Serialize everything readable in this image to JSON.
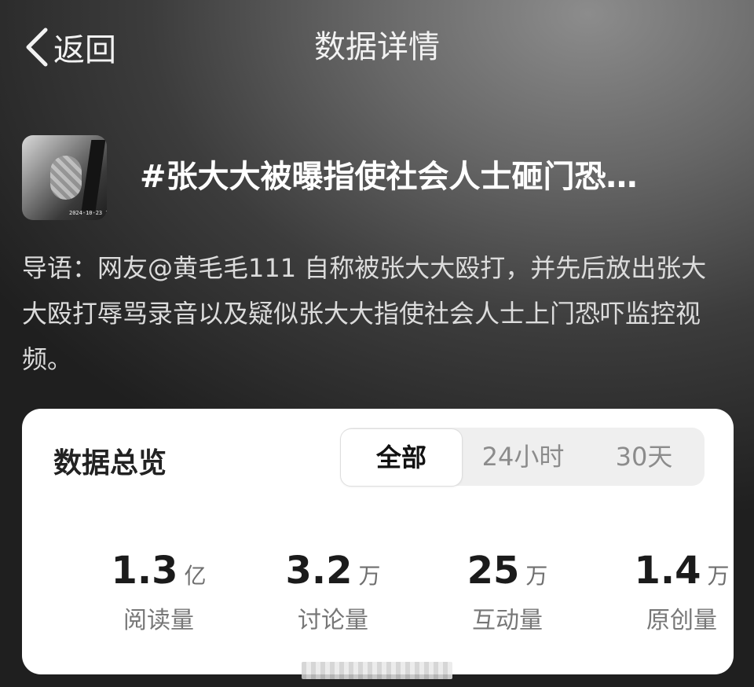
{
  "header": {
    "back_label": "返回",
    "title": "数据详情"
  },
  "topic": {
    "title": "#张大大被曝指使社会人士砸门恐…",
    "thumb_timestamp": "2024-10-23 2",
    "intro": "导语：网友@黄毛毛111 自称被张大大殴打，并先后放出张大大殴打辱骂录音以及疑似张大大指使社会人士上门恐吓监控视频。"
  },
  "overview": {
    "title": "数据总览",
    "tabs": [
      {
        "label": "全部",
        "active": true
      },
      {
        "label": "24小时",
        "active": false
      },
      {
        "label": "30天",
        "active": false
      }
    ],
    "stats": [
      {
        "value": "1.3",
        "unit": "亿",
        "label": "阅读量"
      },
      {
        "value": "3.2",
        "unit": "万",
        "label": "讨论量"
      },
      {
        "value": "25",
        "unit": "万",
        "label": "互动量"
      },
      {
        "value": "1.4",
        "unit": "万",
        "label": "原创量"
      }
    ]
  },
  "icons": {
    "back": "chevron-left-icon"
  },
  "colors": {
    "card_bg": "#ffffff",
    "tab_track": "#efefef",
    "muted_text": "#8c8c8c"
  }
}
